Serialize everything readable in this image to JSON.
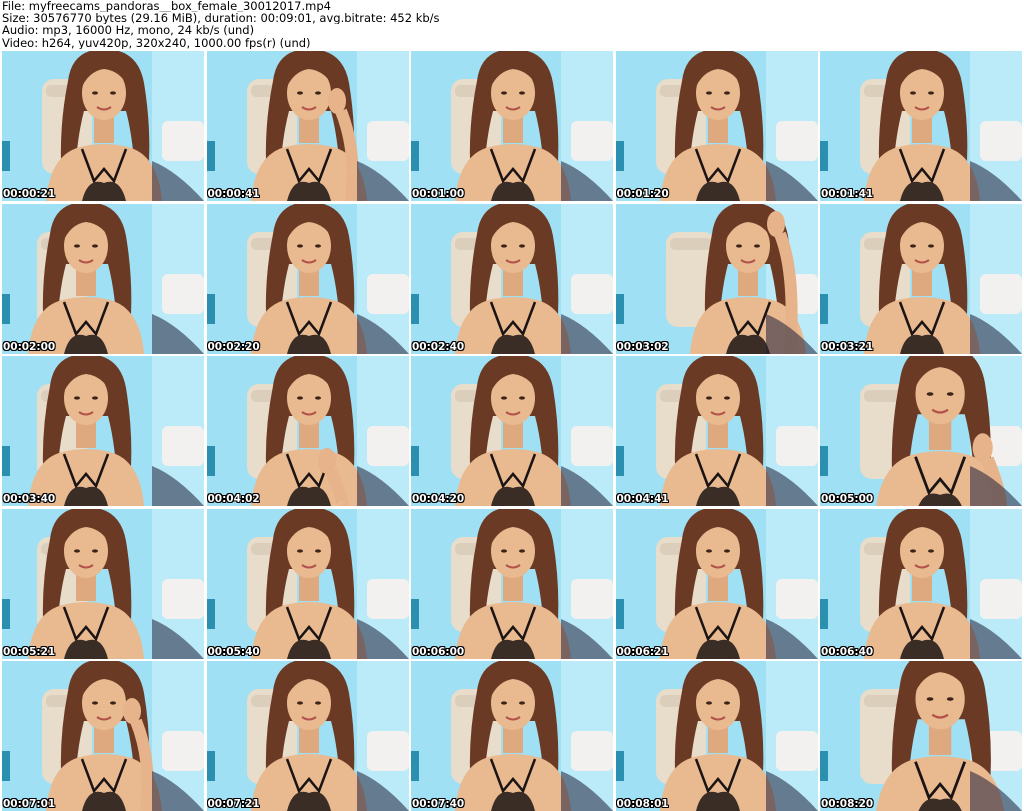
{
  "header": {
    "file_line": "File: myfreecams_pandoras__box_female_30012017.mp4",
    "size_line": "Size: 30576770 bytes (29.16 MiB), duration: 00:09:01, avg.bitrate: 452 kb/s",
    "audio_line": "Audio: mp3, 16000 Hz, mono, 24 kb/s (und)",
    "video_line": "Video: h264, yuv420p, 320x240, 1000.00 fps(r) (und)"
  },
  "colors": {
    "background": "#ffffff",
    "wall": "#9fe0f4",
    "wall_light": "#c8f0fb",
    "chair": "#e8dccb",
    "hair": "#6b3a24",
    "skin": "#e9b990",
    "lingerie": "#1b1414",
    "timestamp_text": "#ffffff",
    "timestamp_outline": "#000000"
  },
  "thumbnails": [
    {
      "time": "00:00:21",
      "variant": "center",
      "pose": "normal"
    },
    {
      "time": "00:00:41",
      "variant": "center",
      "pose": "hand-face"
    },
    {
      "time": "00:01:00",
      "variant": "center",
      "pose": "normal"
    },
    {
      "time": "00:01:20",
      "variant": "center",
      "pose": "normal"
    },
    {
      "time": "00:01:41",
      "variant": "center",
      "pose": "normal"
    },
    {
      "time": "00:02:00",
      "variant": "left",
      "pose": "normal"
    },
    {
      "time": "00:02:20",
      "variant": "center",
      "pose": "normal"
    },
    {
      "time": "00:02:40",
      "variant": "center",
      "pose": "normal"
    },
    {
      "time": "00:03:02",
      "variant": "lean",
      "pose": "hand-head"
    },
    {
      "time": "00:03:21",
      "variant": "center",
      "pose": "normal"
    },
    {
      "time": "00:03:40",
      "variant": "left",
      "pose": "normal"
    },
    {
      "time": "00:04:02",
      "variant": "center",
      "pose": "hand-chest"
    },
    {
      "time": "00:04:20",
      "variant": "center",
      "pose": "normal"
    },
    {
      "time": "00:04:41",
      "variant": "center",
      "pose": "normal"
    },
    {
      "time": "00:05:00",
      "variant": "close",
      "pose": "hand-hair"
    },
    {
      "time": "00:05:21",
      "variant": "left",
      "pose": "normal"
    },
    {
      "time": "00:05:40",
      "variant": "center",
      "pose": "normal"
    },
    {
      "time": "00:06:00",
      "variant": "center",
      "pose": "normal"
    },
    {
      "time": "00:06:21",
      "variant": "center",
      "pose": "normal"
    },
    {
      "time": "00:06:40",
      "variant": "center",
      "pose": "normal"
    },
    {
      "time": "00:07:01",
      "variant": "center",
      "pose": "hand-face"
    },
    {
      "time": "00:07:21",
      "variant": "center",
      "pose": "normal"
    },
    {
      "time": "00:07:40",
      "variant": "center",
      "pose": "normal"
    },
    {
      "time": "00:08:01",
      "variant": "center",
      "pose": "normal"
    },
    {
      "time": "00:08:20",
      "variant": "close",
      "pose": "normal"
    }
  ]
}
